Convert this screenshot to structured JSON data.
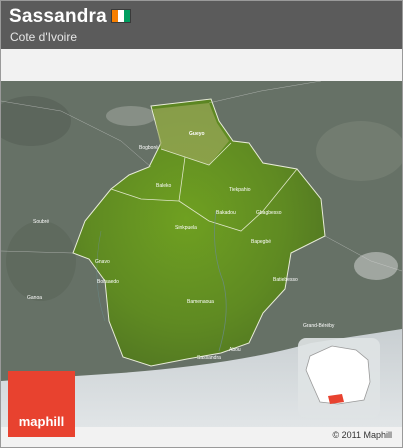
{
  "header": {
    "title": "Sassandra",
    "subtitle": "Cote d'Ivoire"
  },
  "flag": {
    "colors": [
      "#f77f00",
      "#ffffff",
      "#009e60"
    ]
  },
  "map": {
    "place_labels": [
      "Gueyo",
      "Bogboré",
      "Baleko",
      "Bakadou",
      "Gbagbesso",
      "Sinkpuela",
      "Tiekpahio",
      "Bapegbé",
      "Gnavo",
      "Bolisaedo",
      "Batiebesso",
      "Soubré",
      "Bamenaoua",
      "Abou",
      "Grand-Béréby",
      "Sassandra",
      "Ganoa"
    ],
    "colors": {
      "region": "#6f9a2a",
      "surroundings": "#6a7569",
      "sea": "#cfd4d6"
    }
  },
  "logo": {
    "text": "maphill"
  },
  "footer": {
    "copyright": "© 2011 Maphill"
  }
}
